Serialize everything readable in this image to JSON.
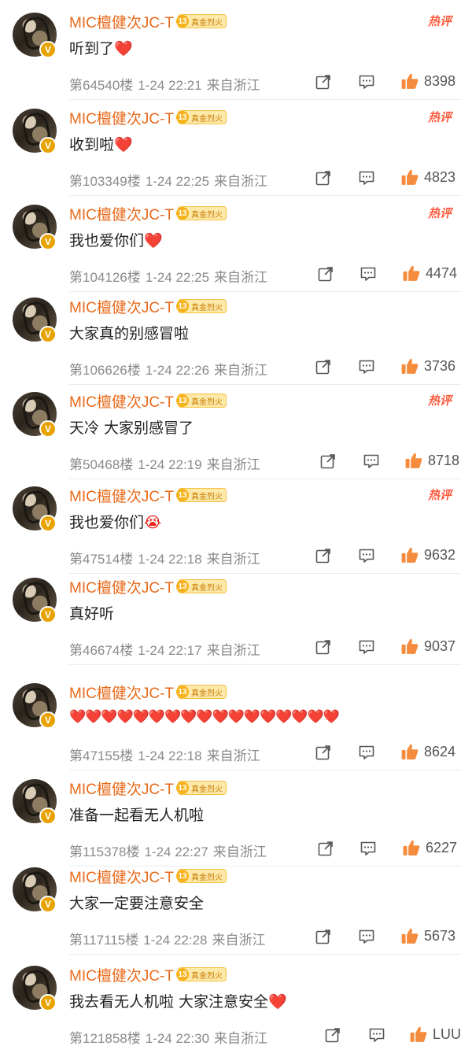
{
  "comments": [
    {
      "username": "MIC檀健次JC-T",
      "fan_level": "13",
      "fan_label": "真金烈火",
      "hot": "热评",
      "text": "听到了",
      "emoji": "❤️",
      "floor": "第64540楼",
      "time": "1-24 22:21",
      "location": "来自浙江",
      "likes": "8398"
    },
    {
      "username": "MIC檀健次JC-T",
      "fan_level": "13",
      "fan_label": "真金烈火",
      "hot": "热评",
      "text": "收到啦",
      "emoji": "❤️",
      "floor": "第103349楼",
      "time": "1-24 22:25",
      "location": "来自浙江",
      "likes": "4823"
    },
    {
      "username": "MIC檀健次JC-T",
      "fan_level": "13",
      "fan_label": "真金烈火",
      "hot": "热评",
      "text": "我也爱你们",
      "emoji": "❤️",
      "floor": "第104126楼",
      "time": "1-24 22:25",
      "location": "来自浙江",
      "likes": "4474"
    },
    {
      "username": "MIC檀健次JC-T",
      "fan_level": "13",
      "fan_label": "真金烈火",
      "hot": "",
      "text": "大家真的别感冒啦",
      "emoji": "",
      "floor": "第106626楼",
      "time": "1-24 22:26",
      "location": "来自浙江",
      "likes": "3736"
    },
    {
      "username": "MIC檀健次JC-T",
      "fan_level": "13",
      "fan_label": "真金烈火",
      "hot": "热评",
      "text": "天冷 大家别感冒了",
      "emoji": "",
      "floor": "第50468楼",
      "time": "1-24 22:19",
      "location": "来自浙江",
      "likes": "8718"
    },
    {
      "username": "MIC檀健次JC-T",
      "fan_level": "13",
      "fan_label": "真金烈火",
      "hot": "热评",
      "text": "我也爱你们",
      "emoji": "😭",
      "floor": "第47514楼",
      "time": "1-24 22:18",
      "location": "来自浙江",
      "likes": "9632"
    },
    {
      "username": "MIC檀健次JC-T",
      "fan_level": "13",
      "fan_label": "真金烈火",
      "hot": "",
      "text": "真好听",
      "emoji": "",
      "floor": "第46674楼",
      "time": "1-24 22:17",
      "location": "来自浙江",
      "likes": "9037"
    },
    {
      "username": "MIC檀健次JC-T",
      "fan_level": "13",
      "fan_label": "真金烈火",
      "hot": "",
      "text": "",
      "emoji": "❤️❤️❤️❤️❤️❤️❤️❤️❤️❤️❤️❤️❤️❤️❤️❤️❤️",
      "floor": "第47155楼",
      "time": "1-24 22:18",
      "location": "来自浙江",
      "likes": "8624"
    },
    {
      "username": "MIC檀健次JC-T",
      "fan_level": "13",
      "fan_label": "真金烈火",
      "hot": "",
      "text": "准备一起看无人机啦",
      "emoji": "",
      "floor": "第115378楼",
      "time": "1-24 22:27",
      "location": "来自浙江",
      "likes": "6227"
    },
    {
      "username": "MIC檀健次JC-T",
      "fan_level": "13",
      "fan_label": "真金烈火",
      "hot": "",
      "text": "大家一定要注意安全",
      "emoji": "",
      "floor": "第117115楼",
      "time": "1-24 22:28",
      "location": "来自浙江",
      "likes": "5673"
    },
    {
      "username": "MIC檀健次JC-T",
      "fan_level": "13",
      "fan_label": "真金烈火",
      "hot": "",
      "text": "我去看无人机啦 大家注意安全",
      "emoji": "❤️",
      "floor": "第121858楼",
      "time": "1-24 22:30",
      "location": "来自浙江",
      "likes": "LUU"
    }
  ],
  "icons": {
    "share": "share-icon",
    "comment": "comment-icon",
    "like": "thumbs-up-icon",
    "verified": "verified-v-badge"
  },
  "colors": {
    "username": "#e86b1c",
    "hot": "#ff5a3d",
    "like": "#f58b3c",
    "meta": "#8a8a8a",
    "badge": "#f6b21a"
  }
}
